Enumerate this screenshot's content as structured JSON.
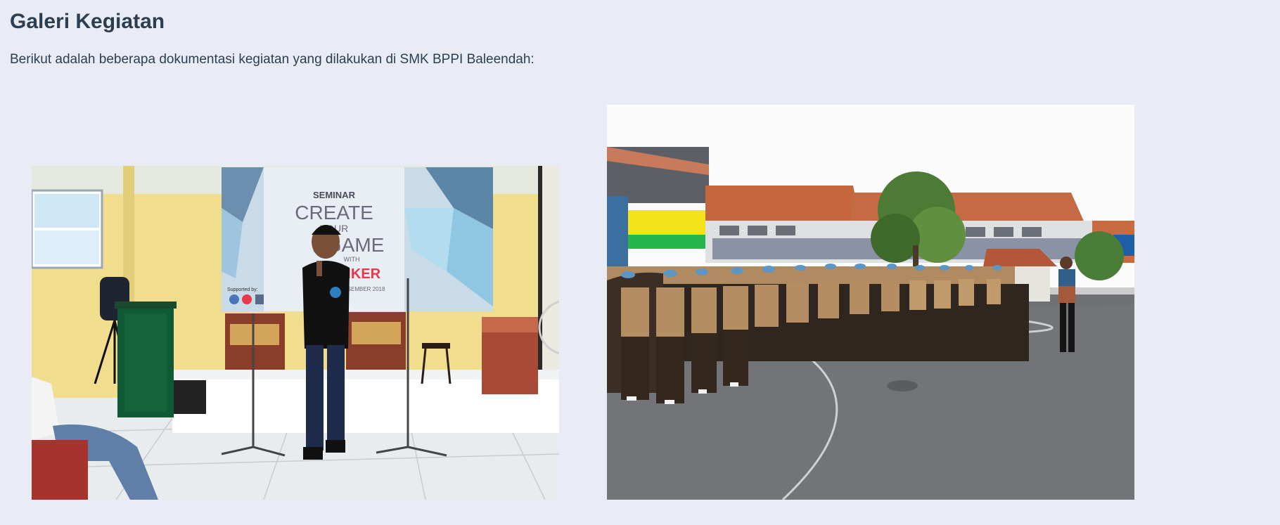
{
  "gallery": {
    "title": "Galeri Kegiatan",
    "intro": "Berikut adalah beberapa dokumentasi kegiatan yang dilakukan di SMK BPPI Baleendah:"
  },
  "photo1": {
    "banner_line1": "SEMINAR",
    "banner_line2": "CREATE",
    "banner_line3": "YOUR",
    "banner_line4": "NGAME",
    "banner_line5": "WITH",
    "banner_line6": "INKER",
    "banner_line7": "DESEMBER 2018",
    "banner_supported": "Supported by:"
  },
  "colors": {
    "background": "#e9ecf4",
    "heading": "#2c3e50",
    "banner_accent": "#e8394a"
  }
}
